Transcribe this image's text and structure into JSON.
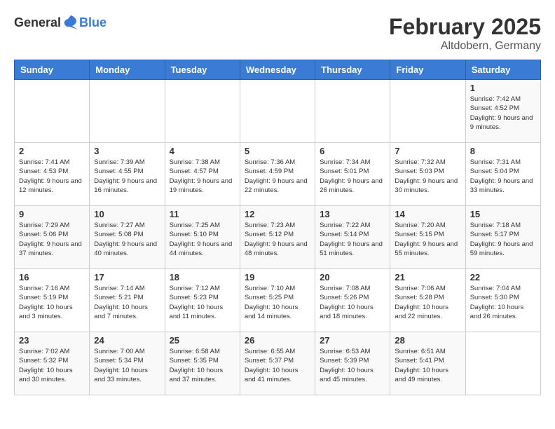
{
  "header": {
    "logo_general": "General",
    "logo_blue": "Blue",
    "month_title": "February 2025",
    "location": "Altdobern, Germany"
  },
  "days_of_week": [
    "Sunday",
    "Monday",
    "Tuesday",
    "Wednesday",
    "Thursday",
    "Friday",
    "Saturday"
  ],
  "weeks": [
    [
      {
        "day": "",
        "info": ""
      },
      {
        "day": "",
        "info": ""
      },
      {
        "day": "",
        "info": ""
      },
      {
        "day": "",
        "info": ""
      },
      {
        "day": "",
        "info": ""
      },
      {
        "day": "",
        "info": ""
      },
      {
        "day": "1",
        "info": "Sunrise: 7:42 AM\nSunset: 4:52 PM\nDaylight: 9 hours and 9 minutes."
      }
    ],
    [
      {
        "day": "2",
        "info": "Sunrise: 7:41 AM\nSunset: 4:53 PM\nDaylight: 9 hours and 12 minutes."
      },
      {
        "day": "3",
        "info": "Sunrise: 7:39 AM\nSunset: 4:55 PM\nDaylight: 9 hours and 16 minutes."
      },
      {
        "day": "4",
        "info": "Sunrise: 7:38 AM\nSunset: 4:57 PM\nDaylight: 9 hours and 19 minutes."
      },
      {
        "day": "5",
        "info": "Sunrise: 7:36 AM\nSunset: 4:59 PM\nDaylight: 9 hours and 22 minutes."
      },
      {
        "day": "6",
        "info": "Sunrise: 7:34 AM\nSunset: 5:01 PM\nDaylight: 9 hours and 26 minutes."
      },
      {
        "day": "7",
        "info": "Sunrise: 7:32 AM\nSunset: 5:03 PM\nDaylight: 9 hours and 30 minutes."
      },
      {
        "day": "8",
        "info": "Sunrise: 7:31 AM\nSunset: 5:04 PM\nDaylight: 9 hours and 33 minutes."
      }
    ],
    [
      {
        "day": "9",
        "info": "Sunrise: 7:29 AM\nSunset: 5:06 PM\nDaylight: 9 hours and 37 minutes."
      },
      {
        "day": "10",
        "info": "Sunrise: 7:27 AM\nSunset: 5:08 PM\nDaylight: 9 hours and 40 minutes."
      },
      {
        "day": "11",
        "info": "Sunrise: 7:25 AM\nSunset: 5:10 PM\nDaylight: 9 hours and 44 minutes."
      },
      {
        "day": "12",
        "info": "Sunrise: 7:23 AM\nSunset: 5:12 PM\nDaylight: 9 hours and 48 minutes."
      },
      {
        "day": "13",
        "info": "Sunrise: 7:22 AM\nSunset: 5:14 PM\nDaylight: 9 hours and 51 minutes."
      },
      {
        "day": "14",
        "info": "Sunrise: 7:20 AM\nSunset: 5:15 PM\nDaylight: 9 hours and 55 minutes."
      },
      {
        "day": "15",
        "info": "Sunrise: 7:18 AM\nSunset: 5:17 PM\nDaylight: 9 hours and 59 minutes."
      }
    ],
    [
      {
        "day": "16",
        "info": "Sunrise: 7:16 AM\nSunset: 5:19 PM\nDaylight: 10 hours and 3 minutes."
      },
      {
        "day": "17",
        "info": "Sunrise: 7:14 AM\nSunset: 5:21 PM\nDaylight: 10 hours and 7 minutes."
      },
      {
        "day": "18",
        "info": "Sunrise: 7:12 AM\nSunset: 5:23 PM\nDaylight: 10 hours and 11 minutes."
      },
      {
        "day": "19",
        "info": "Sunrise: 7:10 AM\nSunset: 5:25 PM\nDaylight: 10 hours and 14 minutes."
      },
      {
        "day": "20",
        "info": "Sunrise: 7:08 AM\nSunset: 5:26 PM\nDaylight: 10 hours and 18 minutes."
      },
      {
        "day": "21",
        "info": "Sunrise: 7:06 AM\nSunset: 5:28 PM\nDaylight: 10 hours and 22 minutes."
      },
      {
        "day": "22",
        "info": "Sunrise: 7:04 AM\nSunset: 5:30 PM\nDaylight: 10 hours and 26 minutes."
      }
    ],
    [
      {
        "day": "23",
        "info": "Sunrise: 7:02 AM\nSunset: 5:32 PM\nDaylight: 10 hours and 30 minutes."
      },
      {
        "day": "24",
        "info": "Sunrise: 7:00 AM\nSunset: 5:34 PM\nDaylight: 10 hours and 33 minutes."
      },
      {
        "day": "25",
        "info": "Sunrise: 6:58 AM\nSunset: 5:35 PM\nDaylight: 10 hours and 37 minutes."
      },
      {
        "day": "26",
        "info": "Sunrise: 6:55 AM\nSunset: 5:37 PM\nDaylight: 10 hours and 41 minutes."
      },
      {
        "day": "27",
        "info": "Sunrise: 6:53 AM\nSunset: 5:39 PM\nDaylight: 10 hours and 45 minutes."
      },
      {
        "day": "28",
        "info": "Sunrise: 6:51 AM\nSunset: 5:41 PM\nDaylight: 10 hours and 49 minutes."
      },
      {
        "day": "",
        "info": ""
      }
    ]
  ]
}
